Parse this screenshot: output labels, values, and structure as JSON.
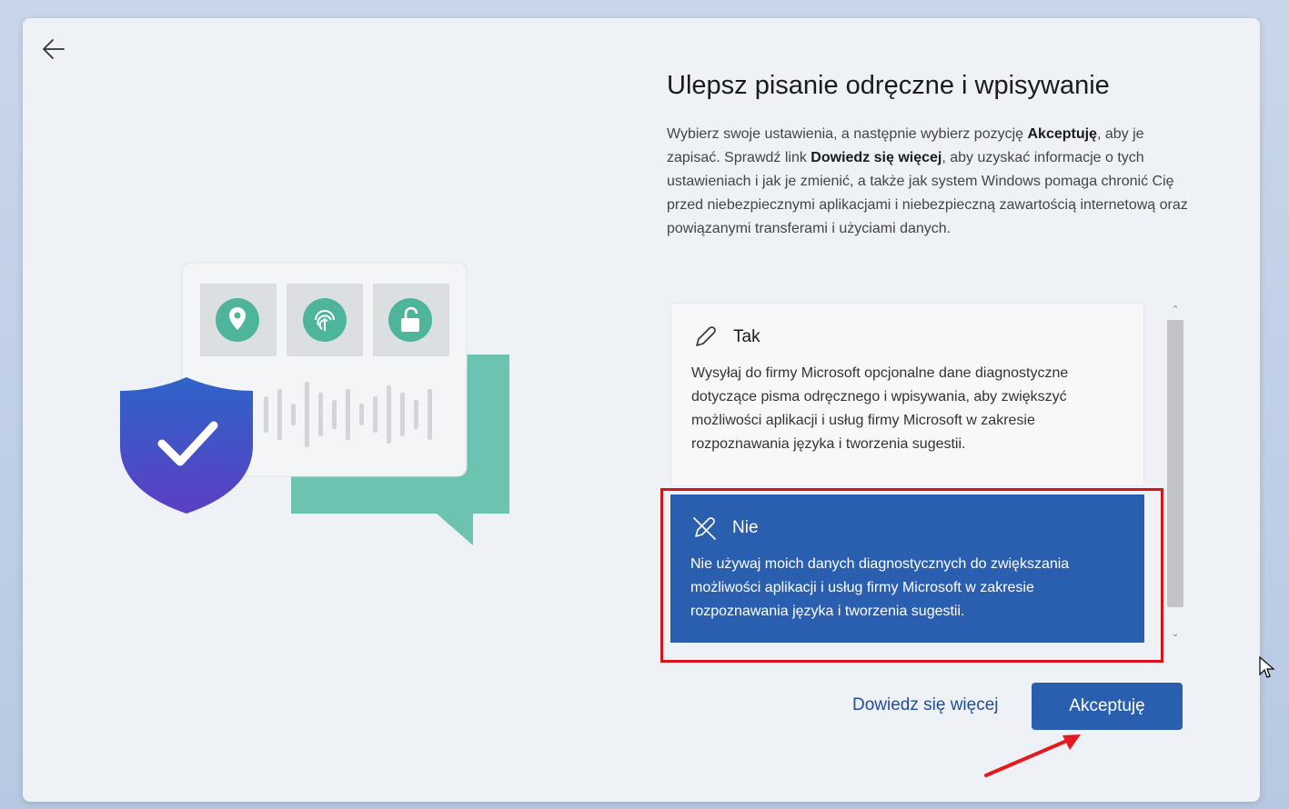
{
  "header": {
    "back_icon": "arrow-left-icon"
  },
  "main": {
    "title": "Ulepsz pisanie odręczne i wpisywanie",
    "description_parts": {
      "p1": "Wybierz swoje ustawienia, a następnie wybierz pozycję ",
      "b1": "Akceptuję",
      "p2": ", aby je zapisać. Sprawdź link ",
      "b2": "Dowiedz się więcej",
      "p3": ", aby uzyskać informacje o tych ustawieniach i jak je zmienić, a także jak system Windows pomaga chronić Cię przed niebezpiecznymi aplikacjami i niebezpieczną zawartością internetową oraz powiązanymi transferami i użyciami danych."
    }
  },
  "options": [
    {
      "label": "Tak",
      "icon": "pen-icon",
      "text": "Wysyłaj do firmy Microsoft opcjonalne dane diagnostyczne dotyczące pisma odręcznego i wpisywania, aby zwiększyć możliwości aplikacji i usług firmy Microsoft w zakresie rozpoznawania języka i tworzenia sugestii.",
      "selected": false
    },
    {
      "label": "Nie",
      "icon": "pen-off-icon",
      "text": "Nie używaj moich danych diagnostycznych do zwiększania możliwości aplikacji i usług firmy Microsoft w zakresie rozpoznawania języka i tworzenia sugestii.",
      "selected": true
    }
  ],
  "footer": {
    "learn_more": "Dowiedz się więcej",
    "accept": "Akceptuję"
  },
  "colors": {
    "accent": "#2a5fb0",
    "highlight": "#d7141a",
    "link": "#1f4e99"
  }
}
